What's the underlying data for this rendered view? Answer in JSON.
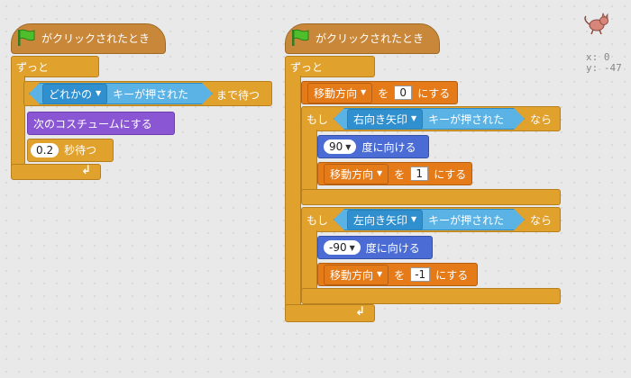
{
  "colors": {
    "events": "#c9873a",
    "control": "#e0a12d",
    "sensing": "#5bb3e5",
    "data": "#e57a18",
    "looks": "#8a56d3",
    "motion": "#4a6cd4"
  },
  "script1": {
    "hat_label": "がクリックされたとき",
    "forever_label": "ずっと",
    "wait_until_key": "どれかの",
    "key_pressed": "キーが押された",
    "wait_until_suffix": "まで待つ",
    "next_costume": "次のコスチュームにする",
    "wait_value": "0.2",
    "wait_suffix": "秒待つ"
  },
  "script2": {
    "hat_label": "がクリックされたとき",
    "forever_label": "ずっと",
    "set_var": "移動方向",
    "set_to": "を",
    "set_value": "0",
    "set_suffix": "にする",
    "if1_label": "もし",
    "if1_key": "右向き矢印",
    "if1_pressed": "キーが押された",
    "if1_then": "なら",
    "point1_value": "90",
    "point_suffix": "度に向ける",
    "set1_var": "移動方向",
    "set1_to": "を",
    "set1_value": "1",
    "set1_suffix": "にする",
    "if2_label": "もし",
    "if2_key": "左向き矢印",
    "if2_pressed": "キーが押された",
    "if2_then": "なら",
    "point2_value": "-90",
    "point2_suffix": "度に向ける",
    "set2_var": "移動方向",
    "set2_to": "を",
    "set2_value": "-1",
    "set2_suffix": "にする"
  },
  "stage_info": {
    "x_label": "x: 0",
    "y_label": "y: -47"
  }
}
